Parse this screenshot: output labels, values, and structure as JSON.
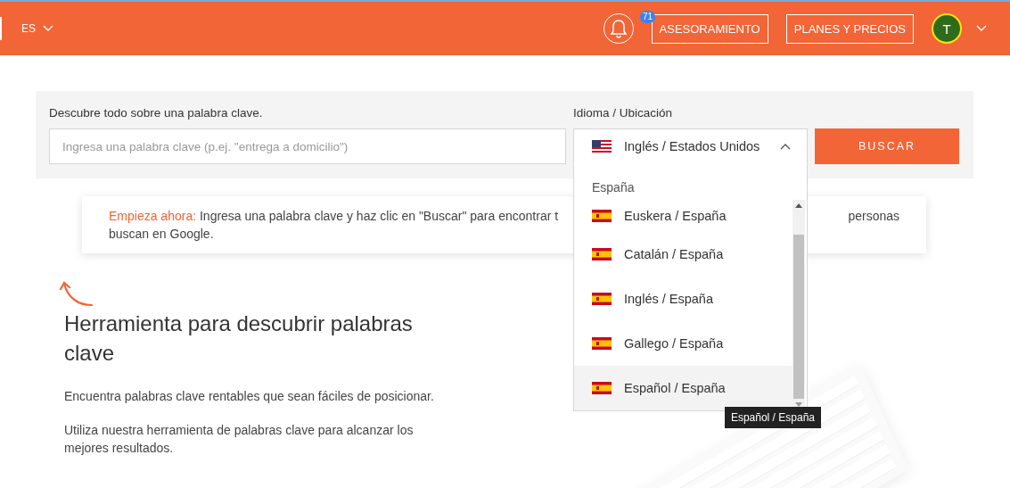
{
  "header": {
    "language": "ES",
    "notifications": "71",
    "buttons": [
      "ASESORAMIENTO",
      "PLANES Y PRECIOS"
    ],
    "avatar": "T"
  },
  "search": {
    "label": "Descubre todo sobre una palabra clave.",
    "placeholder": "Ingresa una palabra clave (p.ej. \"entrega a domicilio\")",
    "locale_label": "Idioma / Ubicación",
    "locale_value": "Inglés / Estados Unidos",
    "expanded": true,
    "button": "BUSCAR"
  },
  "dropdown": {
    "group": "España",
    "items": [
      {
        "label": "Euskera / España",
        "selected": false
      },
      {
        "label": "Catalán / España",
        "selected": false
      },
      {
        "label": "Inglés / España",
        "selected": false
      },
      {
        "label": "Gallego / España",
        "selected": false
      },
      {
        "label": "Español / España",
        "selected": true
      }
    ],
    "tooltip": "Español / España"
  },
  "banner": {
    "lead": "Empieza ahora:",
    "text_1": "Ingresa una palabra clave y haz clic en \"Buscar\" para encontrar t",
    "text_2": "personas",
    "text_3": "buscan en Google."
  },
  "intro": {
    "title": "Herramienta para descubrir palabras clave",
    "paragraphs": [
      "Encuentra palabras clave rentables que sean fáciles de posicionar.",
      "Utiliza nuestra herramienta de palabras clave para alcanzar los mejores resultados."
    ]
  }
}
